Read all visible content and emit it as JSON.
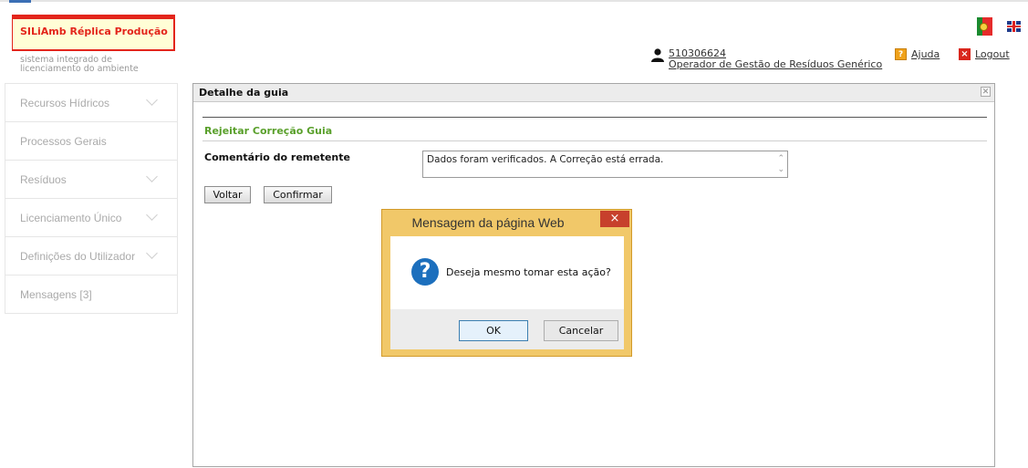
{
  "header": {
    "app_name": "SILiAmb Réplica Produção",
    "tagline": "sistema integrado de licenciamento do ambiente",
    "user": {
      "id": "510306624",
      "role": "Operador de Gestão de Resíduos Genérico"
    },
    "help_label": "Ajuda",
    "logout_label": "Logout",
    "help_icon_glyph": "?",
    "logout_icon_glyph": "×"
  },
  "sidebar": {
    "items": [
      {
        "label": "Recursos Hídricos",
        "has_submenu": true
      },
      {
        "label": "Processos Gerais",
        "has_submenu": false
      },
      {
        "label": "Resíduos",
        "has_submenu": true
      },
      {
        "label": "Licenciamento Único",
        "has_submenu": true
      },
      {
        "label": "Definições do Utilizador",
        "has_submenu": true
      },
      {
        "label": "Mensagens [3]",
        "has_submenu": false
      }
    ]
  },
  "panel": {
    "title": "Detalhe da guia",
    "section_title": "Rejeitar Correção Guia",
    "comment_label": "Comentário do remetente",
    "comment_value": "Dados foram verificados. A Correção está errada.",
    "back_label": "Voltar",
    "confirm_label": "Confirmar"
  },
  "dialog": {
    "title": "Mensagem da página Web",
    "message": "Deseja mesmo tomar esta ação?",
    "ok_label": "OK",
    "cancel_label": "Cancelar",
    "icon_glyph": "?",
    "close_glyph": "×"
  },
  "colors": {
    "brand_red": "#e3251b",
    "section_green": "#5aa02c",
    "dialog_frame": "#f1c869",
    "dialog_close": "#c7402c"
  }
}
